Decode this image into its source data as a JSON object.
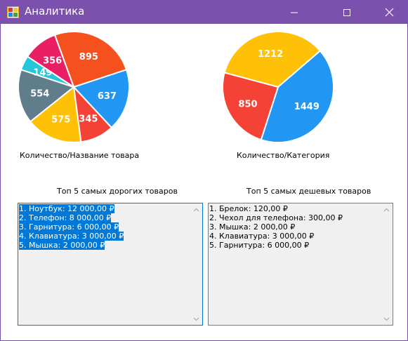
{
  "window": {
    "title": "Аналитика",
    "accent": "#7c50ad"
  },
  "charts": {
    "left": {
      "caption": "Количество/Название товара",
      "chart_data": {
        "type": "pie",
        "values": [
          895,
          637,
          345,
          575,
          554,
          149,
          356
        ],
        "colors": [
          "#f4511e",
          "#2196f3",
          "#f44336",
          "#ffc107",
          "#607d8b",
          "#26c6da",
          "#e91e63"
        ],
        "labels": [
          "895",
          "637",
          "345",
          "575",
          "554",
          "149",
          "356"
        ]
      }
    },
    "right": {
      "caption": "Количество/Категория",
      "chart_data": {
        "type": "pie",
        "values": [
          1212,
          1449,
          850
        ],
        "colors": [
          "#ffc107",
          "#2196f3",
          "#f44336"
        ],
        "labels": [
          "1212",
          "1449",
          "850"
        ]
      }
    }
  },
  "lists": {
    "expensive": {
      "header": "Топ 5 самых дорогих товаров",
      "items": [
        "1. Ноутбук: 12 000,00 ₽",
        "2. Телефон: 8 000,00 ₽",
        "3. Гарнитура: 6 000,00 ₽",
        "4. Клавиатура: 3 000,00 ₽",
        "5. Мышка: 2 000,00 ₽"
      ]
    },
    "cheap": {
      "header": "Топ 5 самых дешевых товаров",
      "items": [
        "1. Брелок: 120,00 ₽",
        "2. Чехол для телефона: 300,00 ₽",
        "3. Мышка: 2 000,00 ₽",
        "4. Клавиатура: 3 000,00 ₽",
        "5. Гарнитура: 6 000,00 ₽"
      ]
    }
  }
}
